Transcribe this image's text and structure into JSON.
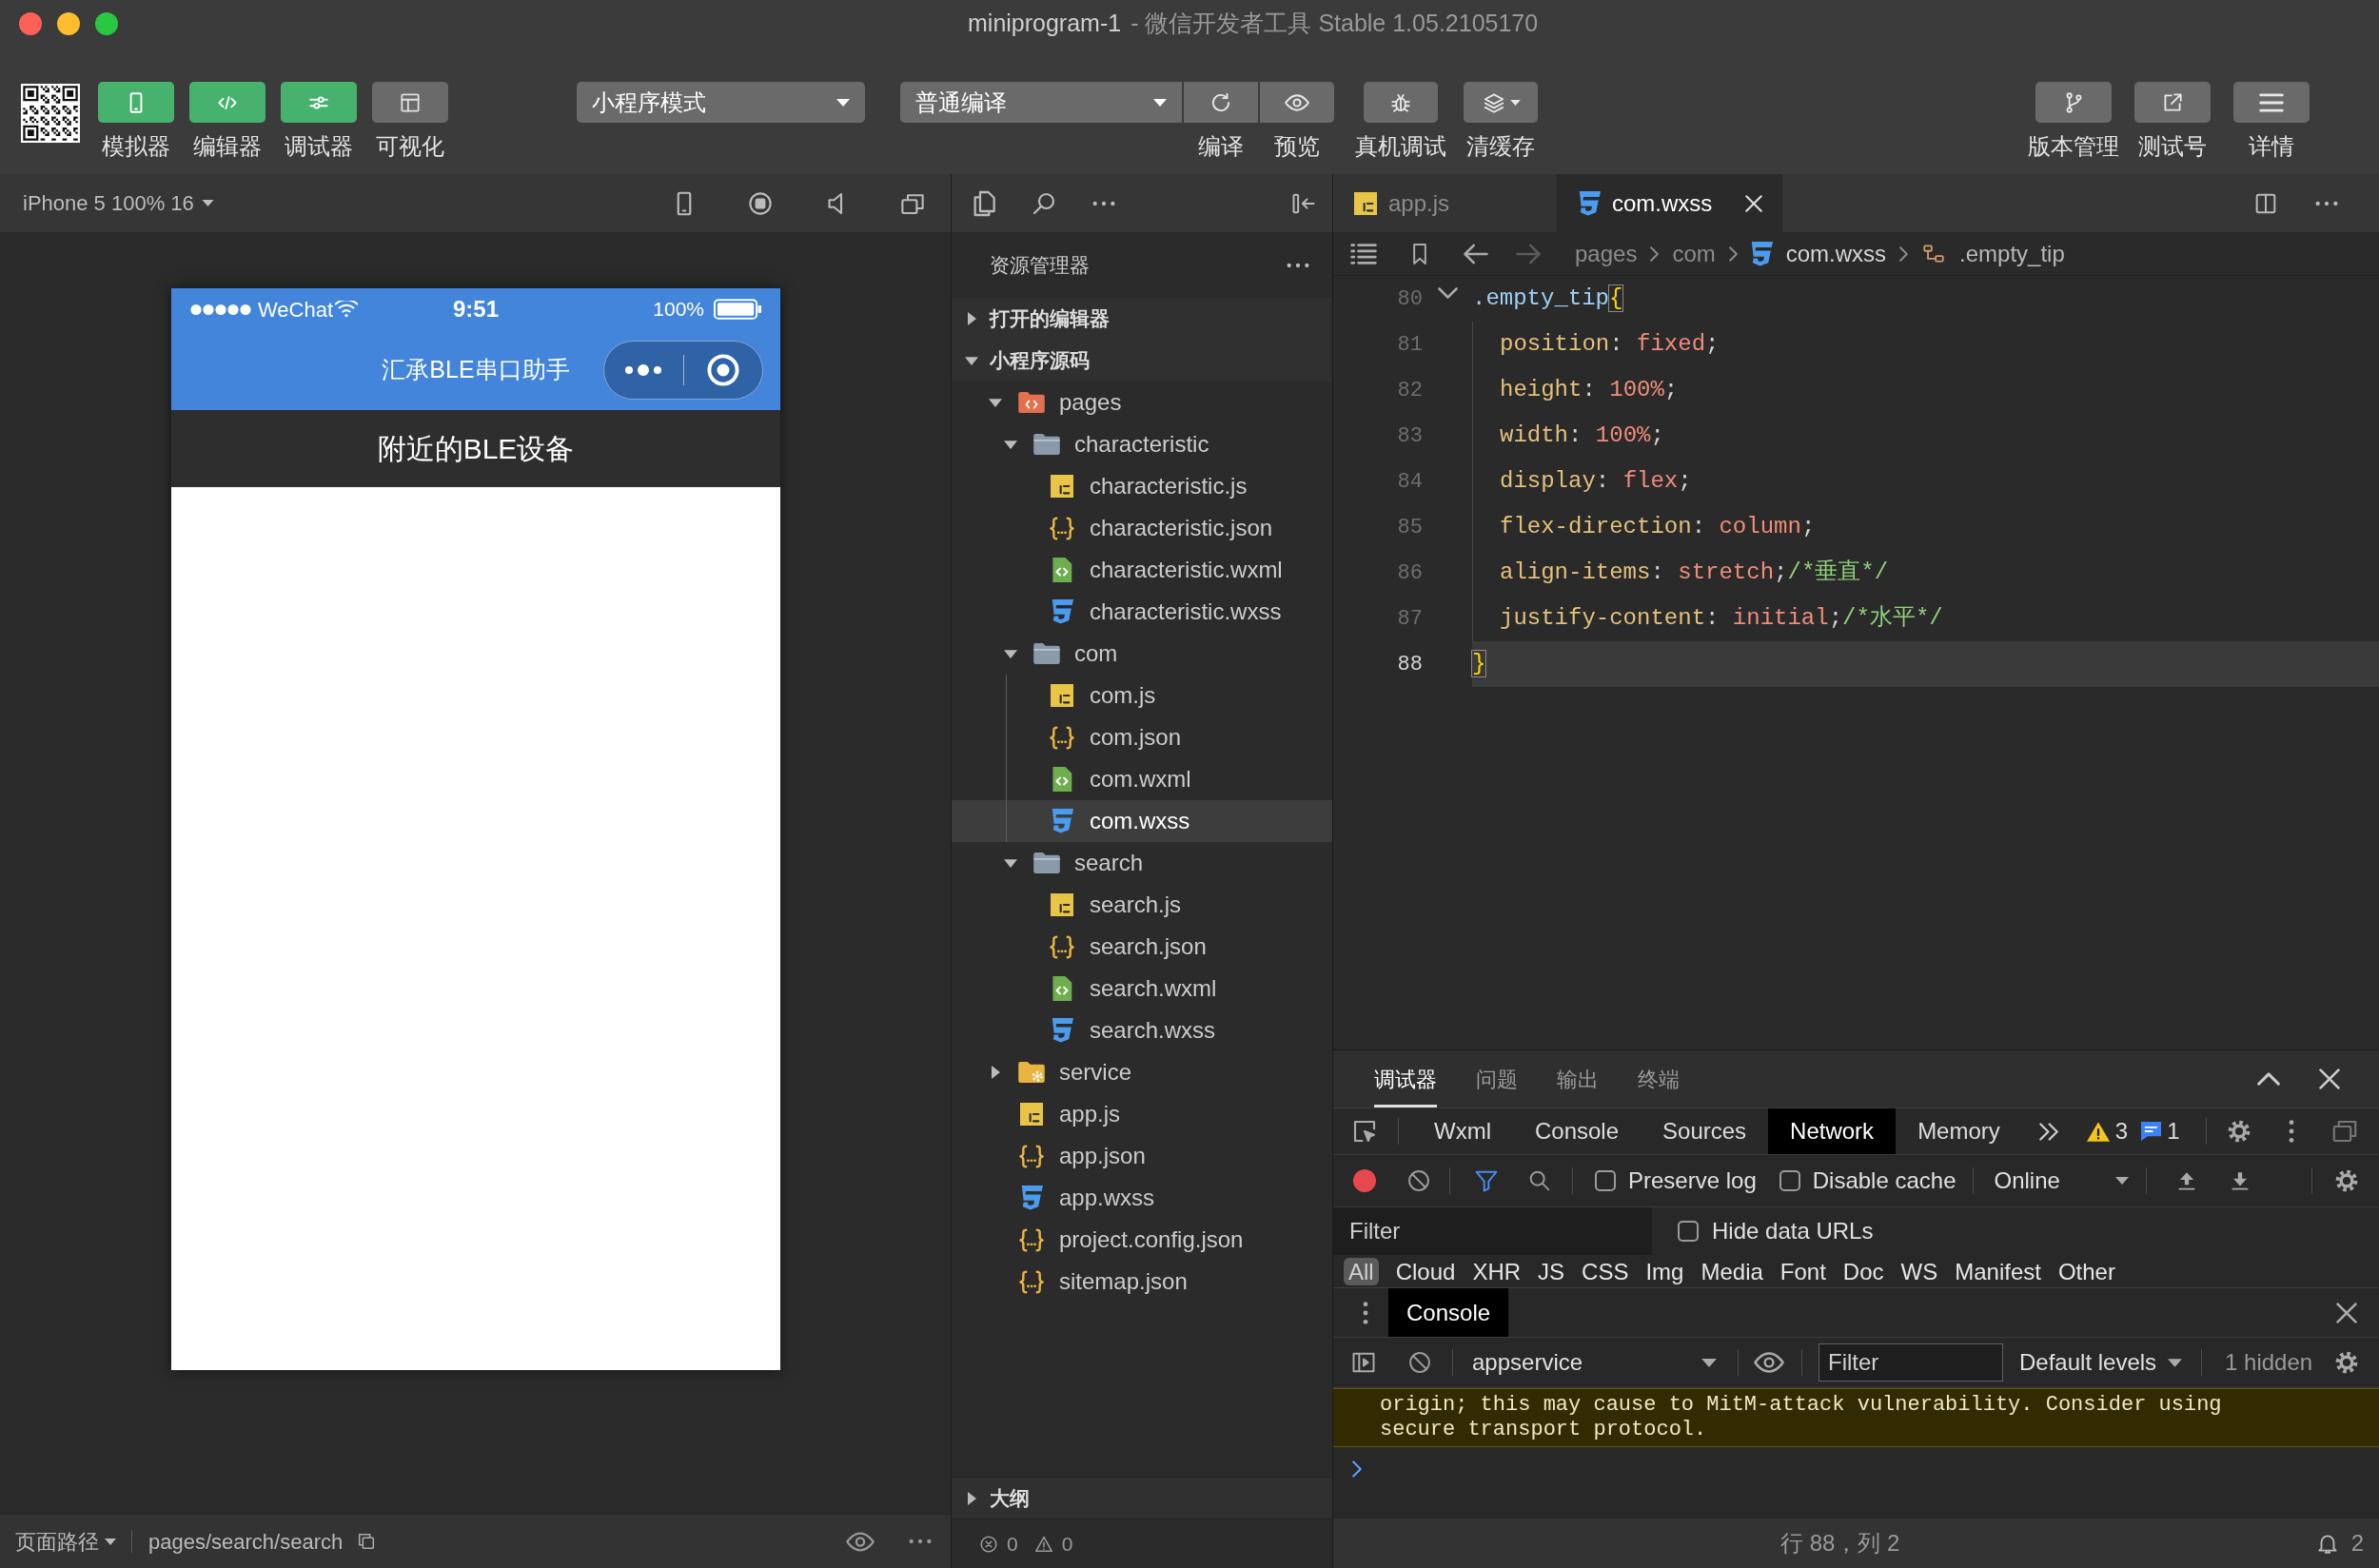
{
  "window": {
    "title": "miniprogram-1",
    "subtitle": "- 微信开发者工具 Stable 1.05.2105170"
  },
  "toolbar": {
    "view_buttons": [
      {
        "label": "模拟器",
        "on": true
      },
      {
        "label": "编辑器",
        "on": true
      },
      {
        "label": "调试器",
        "on": true
      },
      {
        "label": "可视化",
        "on": false
      }
    ],
    "mode_select": {
      "value": "小程序模式"
    },
    "compile_select": {
      "value": "普通编译"
    },
    "compile_actions": [
      {
        "label": "编译"
      },
      {
        "label": "预览"
      }
    ],
    "tool_buttons": [
      {
        "label": "真机调试"
      },
      {
        "label": "清缓存"
      }
    ],
    "right_buttons": [
      {
        "label": "版本管理"
      },
      {
        "label": "测试号"
      },
      {
        "label": "详情"
      }
    ]
  },
  "simulator": {
    "device": "iPhone 5 100% 16",
    "status_bar": {
      "carrier": "WeChat",
      "time": "9:51",
      "battery": "100%"
    },
    "nav_title": "汇承BLE串口助手",
    "page_title": "附近的BLE设备",
    "footer": {
      "path_label": "页面路径",
      "path": "pages/search/search"
    }
  },
  "explorer": {
    "title": "资源管理器",
    "sections": [
      {
        "label": "打开的编辑器",
        "expanded": false
      },
      {
        "label": "小程序源码",
        "expanded": true,
        "children": [
          {
            "name": "pages",
            "kind": "pagefolder",
            "expanded": true,
            "selected": false,
            "children": [
              {
                "name": "characteristic",
                "kind": "folder",
                "expanded": true,
                "selected": false,
                "children": [
                  {
                    "name": "characteristic.js",
                    "kind": "js",
                    "selected": false
                  },
                  {
                    "name": "characteristic.json",
                    "kind": "json",
                    "selected": false
                  },
                  {
                    "name": "characteristic.wxml",
                    "kind": "wxml",
                    "selected": false
                  },
                  {
                    "name": "characteristic.wxss",
                    "kind": "wxss",
                    "selected": false
                  }
                ]
              },
              {
                "name": "com",
                "kind": "folder",
                "expanded": true,
                "selected": false,
                "children": [
                  {
                    "name": "com.js",
                    "kind": "js",
                    "selected": false
                  },
                  {
                    "name": "com.json",
                    "kind": "json",
                    "selected": false
                  },
                  {
                    "name": "com.wxml",
                    "kind": "wxml",
                    "selected": false
                  },
                  {
                    "name": "com.wxss",
                    "kind": "wxss",
                    "selected": true
                  }
                ]
              },
              {
                "name": "search",
                "kind": "folder",
                "expanded": true,
                "selected": false,
                "children": [
                  {
                    "name": "search.js",
                    "kind": "js",
                    "selected": false
                  },
                  {
                    "name": "search.json",
                    "kind": "json",
                    "selected": false
                  },
                  {
                    "name": "search.wxml",
                    "kind": "wxml",
                    "selected": false
                  },
                  {
                    "name": "search.wxss",
                    "kind": "wxss",
                    "selected": false
                  }
                ]
              }
            ]
          },
          {
            "name": "service",
            "kind": "gearfolder",
            "expanded": false,
            "selected": false
          },
          {
            "name": "app.js",
            "kind": "js",
            "selected": false
          },
          {
            "name": "app.json",
            "kind": "json",
            "selected": false
          },
          {
            "name": "app.wxss",
            "kind": "wxss",
            "selected": false
          },
          {
            "name": "project.config.json",
            "kind": "json",
            "selected": false
          },
          {
            "name": "sitemap.json",
            "kind": "json",
            "selected": false
          }
        ]
      }
    ],
    "outline": {
      "label": "大纲",
      "expanded": false
    },
    "problems": {
      "errors": "0",
      "warnings": "0"
    }
  },
  "editor": {
    "tabs": [
      {
        "label": "app.js",
        "kind": "js",
        "selected": false
      },
      {
        "label": "com.wxss",
        "kind": "wxss",
        "selected": true
      }
    ],
    "breadcrumb": [
      {
        "label": "pages",
        "kind": "folder"
      },
      {
        "label": "com",
        "kind": "folder"
      },
      {
        "label": "com.wxss",
        "kind": "wxss"
      },
      {
        "label": ".empty_tip",
        "kind": "selector"
      }
    ],
    "lines": [
      {
        "number": "80",
        "current": false,
        "expanded": true,
        "tokens": [
          {
            "text": ".empty_tip",
            "kind": "selector"
          },
          {
            "text": "{",
            "kind": "open",
            "matched": true
          }
        ]
      },
      {
        "number": "81",
        "current": false,
        "tokens": [
          {
            "text": "position",
            "kind": "property"
          },
          {
            "text": ": ",
            "kind": "punct"
          },
          {
            "text": "fixed",
            "kind": "value"
          },
          {
            "text": ";",
            "kind": "punct"
          }
        ]
      },
      {
        "number": "82",
        "current": false,
        "tokens": [
          {
            "text": "height",
            "kind": "property"
          },
          {
            "text": ": ",
            "kind": "punct"
          },
          {
            "text": "100%",
            "kind": "value"
          },
          {
            "text": ";",
            "kind": "punct"
          }
        ]
      },
      {
        "number": "83",
        "current": false,
        "tokens": [
          {
            "text": "width",
            "kind": "property"
          },
          {
            "text": ": ",
            "kind": "punct"
          },
          {
            "text": "100%",
            "kind": "value"
          },
          {
            "text": ";",
            "kind": "punct"
          }
        ]
      },
      {
        "number": "84",
        "current": false,
        "tokens": [
          {
            "text": "display",
            "kind": "property"
          },
          {
            "text": ": ",
            "kind": "punct"
          },
          {
            "text": "flex",
            "kind": "value"
          },
          {
            "text": ";",
            "kind": "punct"
          }
        ]
      },
      {
        "number": "85",
        "current": false,
        "tokens": [
          {
            "text": "flex-direction",
            "kind": "property"
          },
          {
            "text": ": ",
            "kind": "punct"
          },
          {
            "text": "column",
            "kind": "value"
          },
          {
            "text": ";",
            "kind": "punct"
          }
        ]
      },
      {
        "number": "86",
        "current": false,
        "tokens": [
          {
            "text": "align-items",
            "kind": "property"
          },
          {
            "text": ": ",
            "kind": "punct"
          },
          {
            "text": "stretch",
            "kind": "value"
          },
          {
            "text": ";",
            "kind": "punct"
          },
          {
            "text": "/*垂直*/",
            "kind": "comment"
          }
        ]
      },
      {
        "number": "87",
        "current": false,
        "tokens": [
          {
            "text": "justify-content",
            "kind": "property"
          },
          {
            "text": ": ",
            "kind": "punct"
          },
          {
            "text": "initial",
            "kind": "value"
          },
          {
            "text": ";",
            "kind": "punct"
          },
          {
            "text": "/*水平*/",
            "kind": "comment"
          }
        ]
      },
      {
        "number": "88",
        "current": true,
        "tokens": [
          {
            "text": "}",
            "kind": "close",
            "matched": true
          }
        ]
      }
    ]
  },
  "devtools": {
    "panel_tabs": [
      {
        "label": "调试器",
        "selected": true
      },
      {
        "label": "问题",
        "selected": false
      },
      {
        "label": "输出",
        "selected": false
      },
      {
        "label": "终端",
        "selected": false
      }
    ],
    "tool_tabs": [
      {
        "label": "Wxml",
        "selected": false
      },
      {
        "label": "Console",
        "selected": false
      },
      {
        "label": "Sources",
        "selected": false
      },
      {
        "label": "Network",
        "selected": true
      },
      {
        "label": "Memory",
        "selected": false
      }
    ],
    "issues": {
      "warnings": "3",
      "infos": "1"
    },
    "network": {
      "recording": true,
      "filter_open": true,
      "options": [
        {
          "label": "Preserve log",
          "checked": false
        },
        {
          "label": "Disable cache",
          "checked": false
        }
      ],
      "throttling": "Online",
      "filter": {
        "placeholder": "Filter"
      },
      "hide_data_urls": {
        "label": "Hide data URLs",
        "checked": false
      },
      "types": [
        {
          "label": "All",
          "selected": true
        },
        {
          "label": "Cloud",
          "selected": false
        },
        {
          "label": "XHR",
          "selected": false
        },
        {
          "label": "JS",
          "selected": false
        },
        {
          "label": "CSS",
          "selected": false
        },
        {
          "label": "Img",
          "selected": false
        },
        {
          "label": "Media",
          "selected": false
        },
        {
          "label": "Font",
          "selected": false
        },
        {
          "label": "Doc",
          "selected": false
        },
        {
          "label": "WS",
          "selected": false
        },
        {
          "label": "Manifest",
          "selected": false
        },
        {
          "label": "Other",
          "selected": false
        }
      ]
    },
    "drawer": {
      "tabs": [
        {
          "label": "Console",
          "selected": true
        }
      ],
      "context": "appservice",
      "filter": {
        "placeholder": "Filter"
      },
      "levels": "Default levels",
      "hidden": "1 hidden",
      "messages": [
        {
          "kind": "warning",
          "text": "origin; this may cause to MitM-attack vulnerability. Consider using secure transport protocol."
        }
      ]
    }
  },
  "status_bar": {
    "cursor": "行 88，列 2",
    "notifications": "2"
  }
}
